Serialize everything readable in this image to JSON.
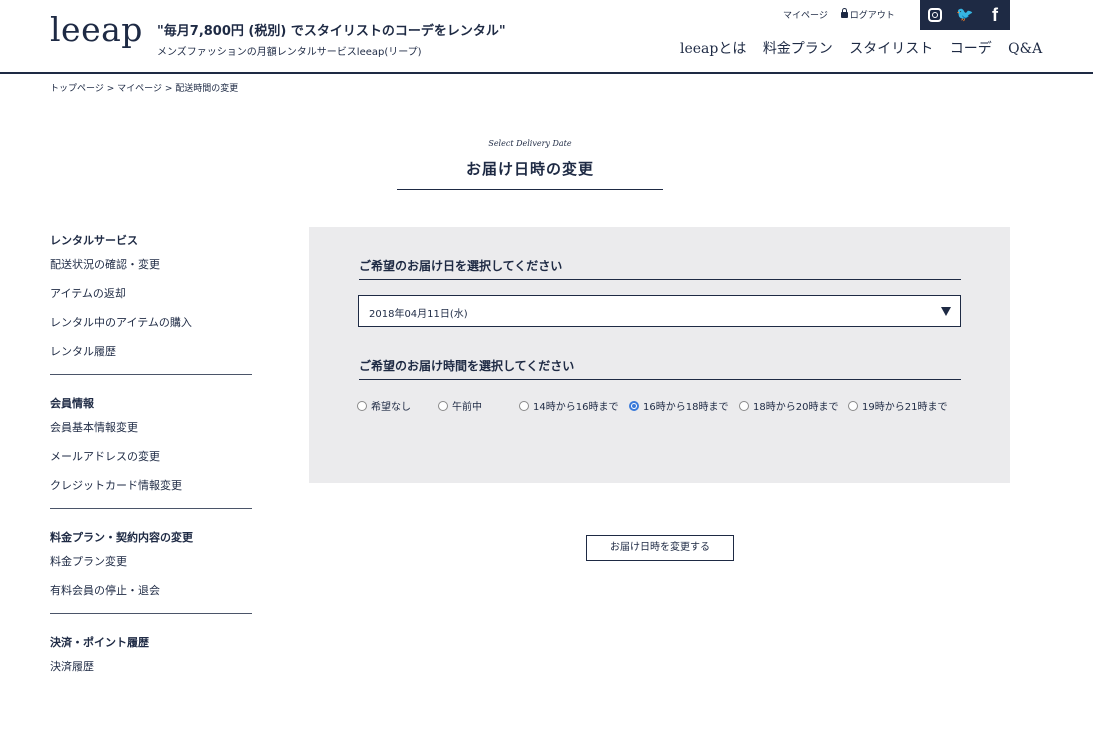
{
  "header": {
    "logo": "leeap",
    "tagline": "\"毎月7,800円 (税別) でスタイリストのコーデをレンタル\"",
    "tagline_sub": "メンズファッションの月額レンタルサービスleeap(リープ)",
    "util": {
      "mypage": "マイページ",
      "logout": "ログアウト"
    },
    "social": [
      "instagram-icon",
      "twitter-icon",
      "facebook-icon"
    ],
    "nav": [
      "leeapとは",
      "料金プラン",
      "スタイリスト",
      "コーデ",
      "Q&A"
    ]
  },
  "breadcrumb": [
    "トップページ",
    "マイページ",
    "配送時間の変更"
  ],
  "breadcrumb_sep": ">",
  "page": {
    "title_en": "Select Delivery Date",
    "title_jp": "お届け日時の変更"
  },
  "sidebar": [
    {
      "heading": "レンタルサービス",
      "items": [
        "配送状況の確認・変更",
        "アイテムの返却",
        "レンタル中のアイテムの購入",
        "レンタル履歴"
      ]
    },
    {
      "heading": "会員情報",
      "items": [
        "会員基本情報変更",
        "メールアドレスの変更",
        "クレジットカード情報変更"
      ]
    },
    {
      "heading": "料金プラン・契約内容の変更",
      "items": [
        "料金プラン変更",
        "有料会員の停止・退会"
      ]
    },
    {
      "heading": "決済・ポイント履歴",
      "items": [
        "決済履歴"
      ]
    }
  ],
  "form": {
    "date_label": "ご希望のお届け日を選択してください",
    "date_value": "2018年04月11日(水)",
    "time_label": "ご希望のお届け時間を選択してください",
    "time_options": [
      "希望なし",
      "午前中",
      "14時から16時まで",
      "16時から18時まで",
      "18時から20時まで",
      "19時から21時まで"
    ],
    "selected_time": "16時から18時まで",
    "submit": "お届け日時を変更する"
  },
  "colors": {
    "navy": "#1e2a44",
    "panel": "#ebebed",
    "radio_accent": "#3a7ad9"
  }
}
